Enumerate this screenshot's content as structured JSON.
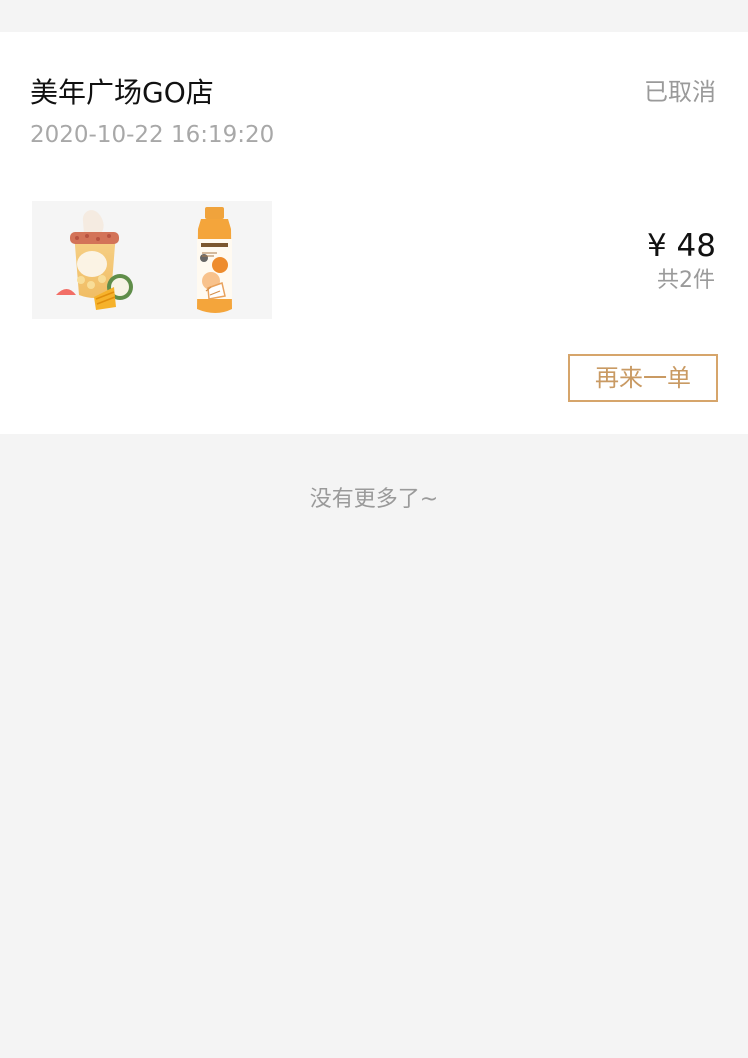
{
  "order": {
    "store_name": "美年广场GO店",
    "status": "已取消",
    "time": "2020-10-22 16:19:20",
    "price": "¥ 48",
    "item_count": "共2件",
    "reorder_label": "再来一单",
    "products": [
      {
        "icon": "mango-coconut-drink-image"
      },
      {
        "icon": "orange-juice-bottle-image"
      }
    ]
  },
  "footer": {
    "no_more_text": "没有更多了~"
  },
  "colors": {
    "page_background": "#f4f4f4",
    "card_background": "#ffffff",
    "primary_text": "#111111",
    "secondary_text": "#9a9a9a",
    "accent": "#d6a56b"
  }
}
